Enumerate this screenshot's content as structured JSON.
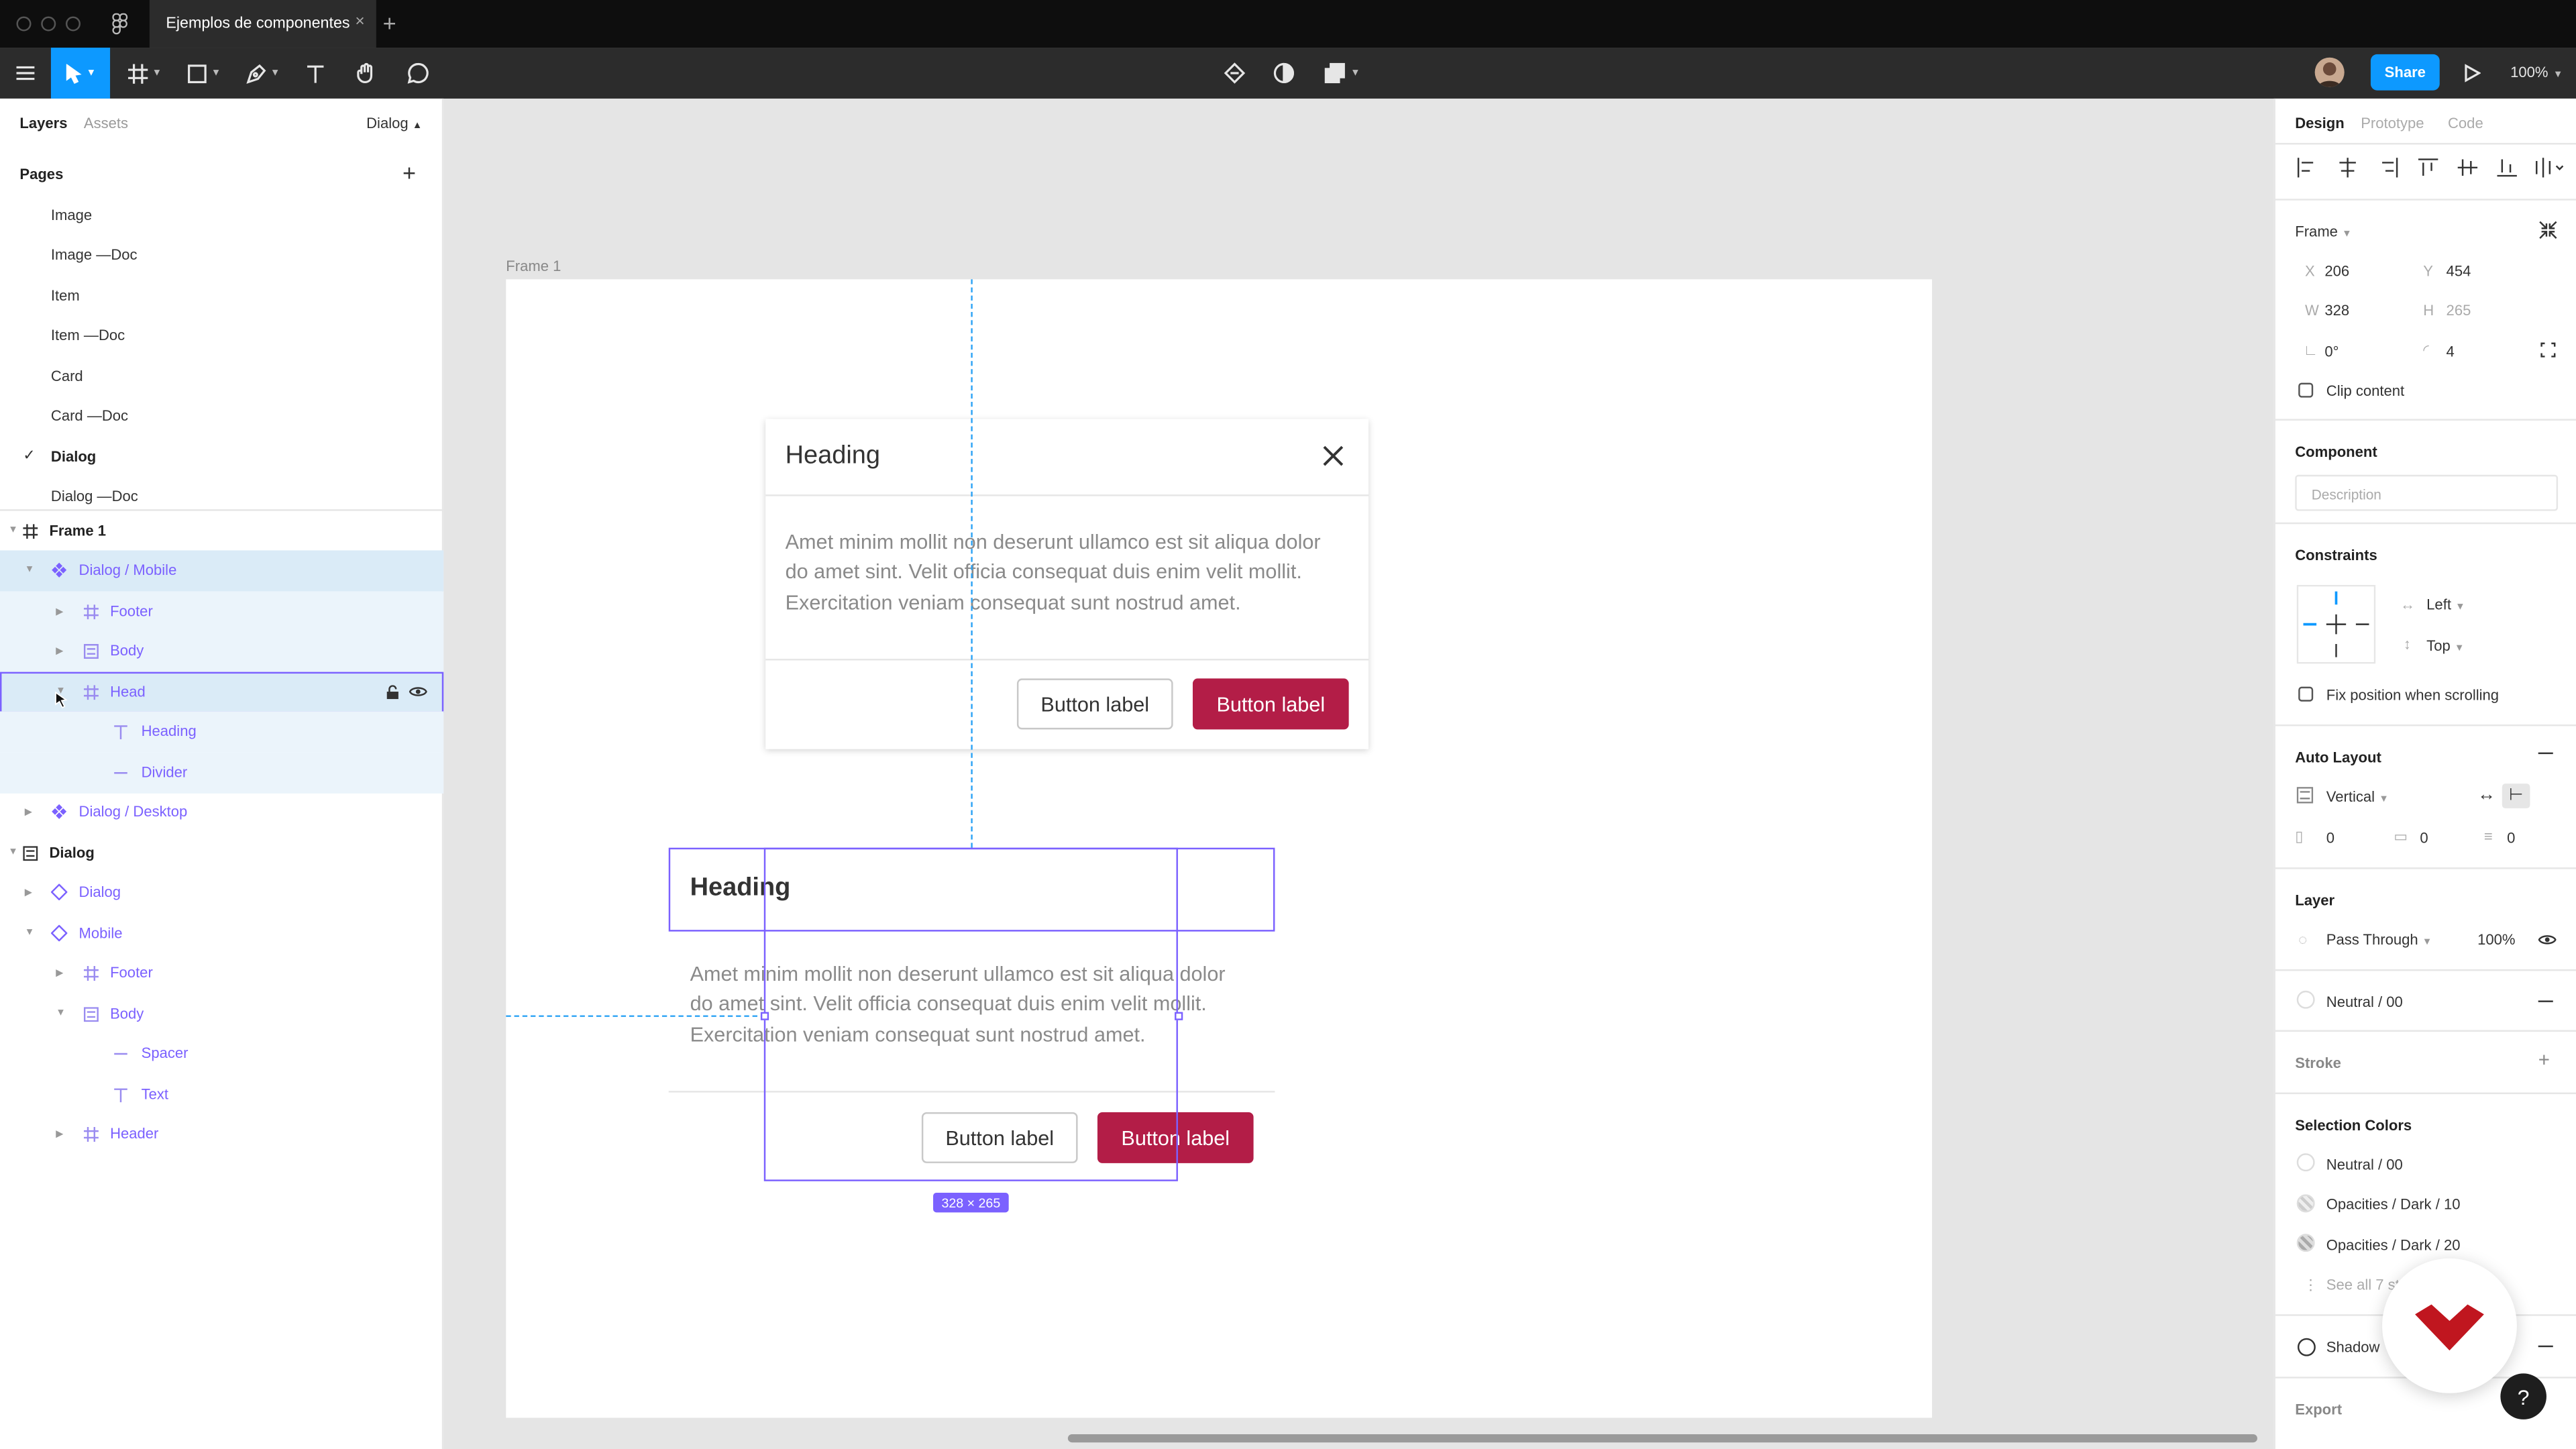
{
  "tab": {
    "title": "Ejemplos de componentes",
    "close": "×",
    "plus": "+"
  },
  "toolbar": {
    "share": "Share",
    "zoom": "100%"
  },
  "left": {
    "tabs": [
      "Layers",
      "Assets"
    ],
    "page_selector": "Dialog",
    "pages_title": "Pages",
    "add": "+",
    "pages": [
      "Image",
      "Image —Doc",
      "Item",
      "Item —Doc",
      "Card",
      "Card —Doc",
      "Dialog",
      "Dialog —Doc"
    ],
    "checkmark": "✓",
    "layers": [
      "Frame 1",
      "Dialog / Mobile",
      "Footer",
      "Body",
      "Head",
      "Heading",
      "Divider",
      "Dialog / Desktop",
      "Dialog",
      "Dialog",
      "Mobile",
      "Footer",
      "Body",
      "Spacer",
      "Text",
      "Header"
    ]
  },
  "canvas": {
    "frame_label": "Frame 1",
    "heading": "Heading",
    "body_lines": [
      "Amet minim mollit non deserunt ullamco est sit aliqua dolor",
      "do amet sint. Velit officia consequat duis enim velit mollit.",
      "Exercitation veniam consequat sunt nostrud amet."
    ],
    "btn_secondary": "Button label",
    "btn_primary": "Button label",
    "size_badge": "328 × 265"
  },
  "right": {
    "tabs": [
      "Design",
      "Prototype",
      "Code"
    ],
    "frame_label": "Frame",
    "x_label": "X",
    "x": "206",
    "y_label": "Y",
    "y": "454",
    "w_label": "W",
    "w": "328",
    "h_label": "H",
    "h": "265",
    "rotation": "0°",
    "radius": "4",
    "clip": "Clip content",
    "component_title": "Component",
    "description_placeholder": "Description",
    "constraints_title": "Constraints",
    "constraint_h": "Left",
    "constraint_v": "Top",
    "fix_position": "Fix position when scrolling",
    "autolayout_title": "Auto Layout",
    "direction": "Vertical",
    "spacing": [
      "0",
      "0",
      "0"
    ],
    "layer_title": "Layer",
    "blend": "Pass Through",
    "opacity": "100%",
    "fill": "Neutral / 00",
    "stroke_title": "Stroke",
    "selection_colors_title": "Selection Colors",
    "selection_colors": [
      "Neutral / 00",
      "Opacities / Dark / 10",
      "Opacities / Dark / 20"
    ],
    "see_all": "See all 7 st",
    "shadow": "Shadow",
    "export_title": "Export",
    "help": "?"
  },
  "colors": {
    "accent": "#0d99ff",
    "component": "#7b61ff",
    "primary_button": "#b31d47"
  }
}
